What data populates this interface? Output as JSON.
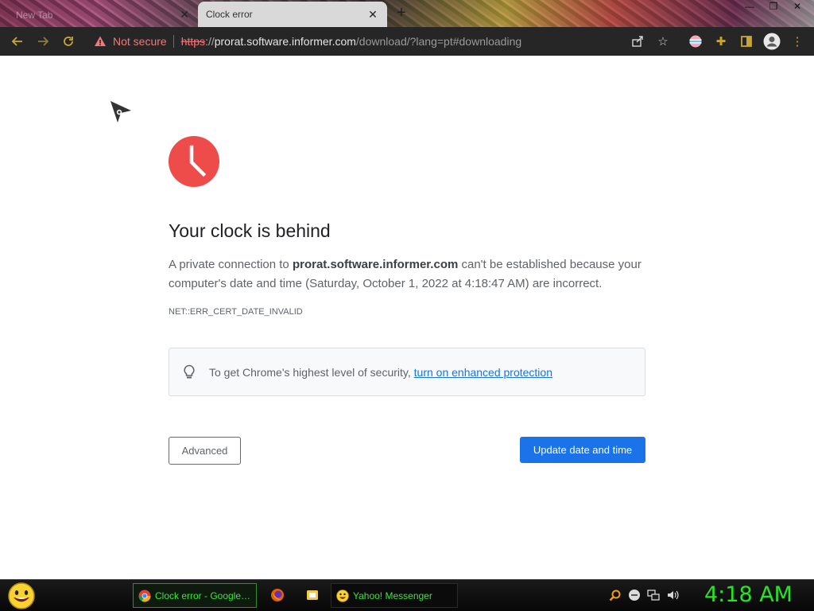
{
  "browser": {
    "tabs": [
      {
        "label": "New Tab",
        "active": false
      },
      {
        "label": "Clock error",
        "active": true
      }
    ],
    "window_controls": [
      "minimize",
      "restore",
      "close"
    ]
  },
  "toolbar": {
    "security_label": "Not secure",
    "url": {
      "scheme": "https",
      "sep": "://",
      "host": "prorat.software.informer.com",
      "path": "/download/?lang=pt#downloading"
    }
  },
  "page": {
    "headline": "Your clock is behind",
    "body_prefix": "A private connection to ",
    "body_host": "prorat.software.informer.com",
    "body_suffix": " can't be established because your computer's date and time (Saturday, October 1, 2022 at 4:18:47 AM) are incorrect.",
    "error_code": "NET::ERR_CERT_DATE_INVALID",
    "enhanced_text": "To get Chrome's highest level of security, ",
    "enhanced_link": "turn on enhanced protection",
    "advanced_button": "Advanced",
    "update_button": "Update date and time"
  },
  "taskbar": {
    "tasks": [
      {
        "label": "Clock error - Google ...",
        "icon": "chrome-icon"
      },
      {
        "label": "Yahoo! Messenger",
        "icon": "yahoo-messenger-icon"
      }
    ],
    "clock": "4:18 AM"
  },
  "colors": {
    "accent": "#1a73e8",
    "error_red": "#ee4b4b",
    "taskbar_text": "#39e639",
    "not_secure": "#f0787a"
  }
}
